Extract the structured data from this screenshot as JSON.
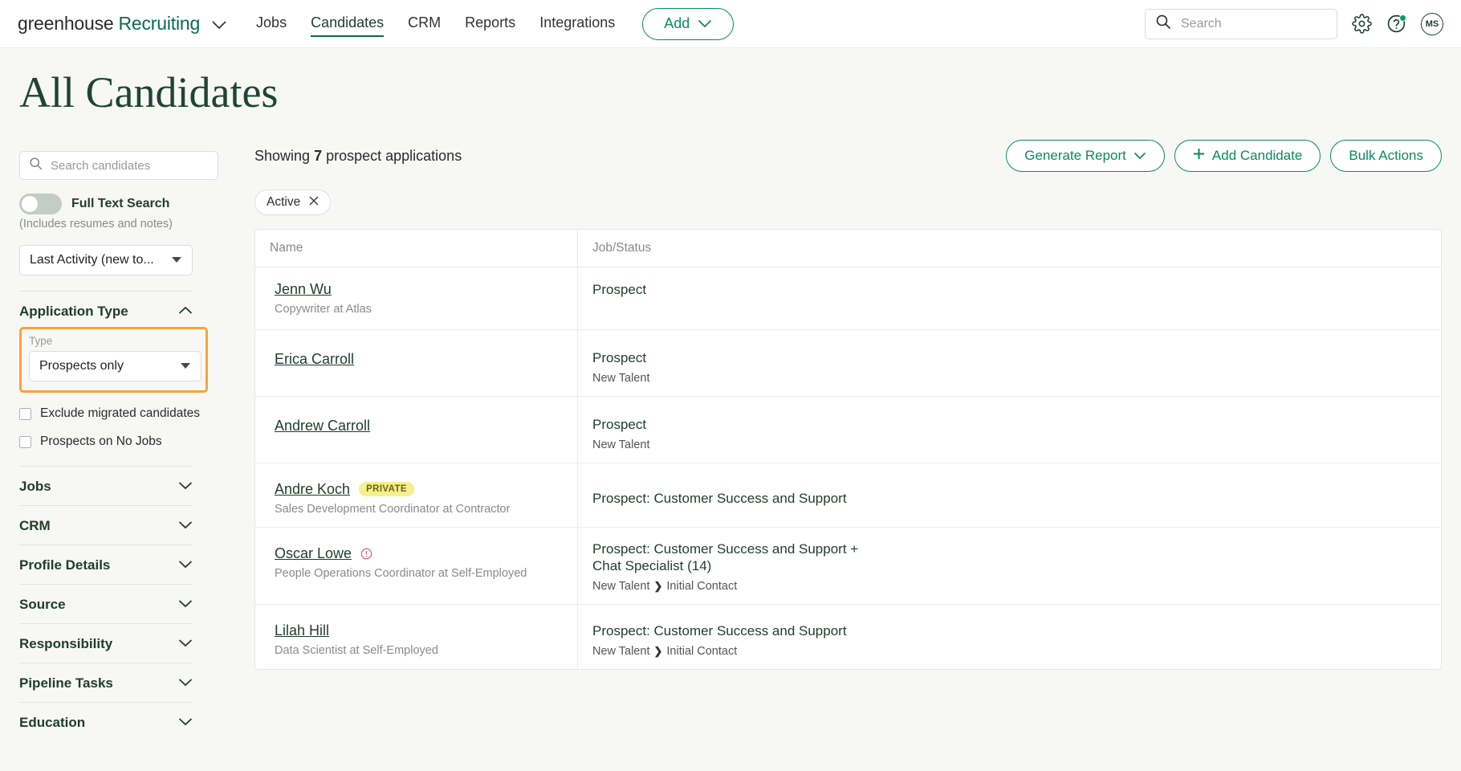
{
  "topnav": {
    "brand_word1": "greenhouse",
    "brand_word2": "Recruiting",
    "links": [
      {
        "label": "Jobs",
        "active": false
      },
      {
        "label": "Candidates",
        "active": true
      },
      {
        "label": "CRM",
        "active": false
      },
      {
        "label": "Reports",
        "active": false
      },
      {
        "label": "Integrations",
        "active": false
      }
    ],
    "add_button": "Add",
    "search_placeholder": "Search",
    "search_value": "",
    "avatar_initials": "MS",
    "icons": {
      "brand_caret": "chevron-down-icon",
      "search": "search-icon",
      "settings": "gear-icon",
      "help": "help-circle-icon",
      "avatar": "avatar"
    }
  },
  "page": {
    "title": "All Candidates"
  },
  "sidebar": {
    "search_placeholder": "Search candidates",
    "search_value": "",
    "full_text_search_label": "Full Text Search",
    "full_text_search_sub": "(Includes resumes and notes)",
    "full_text_search_on": false,
    "sort_select_value": "Last Activity (new to...",
    "application_type": {
      "title": "Application Type",
      "expanded": true,
      "type_field_label": "Type",
      "type_value": "Prospects only",
      "highlight_color": "#F9A33C",
      "checkboxes": [
        {
          "label": "Exclude migrated candidates",
          "checked": false
        },
        {
          "label": "Prospects on No Jobs",
          "checked": false
        }
      ]
    },
    "sections": [
      {
        "label": "Jobs",
        "expanded": false
      },
      {
        "label": "CRM",
        "expanded": false
      },
      {
        "label": "Profile Details",
        "expanded": false
      },
      {
        "label": "Source",
        "expanded": false
      },
      {
        "label": "Responsibility",
        "expanded": false
      },
      {
        "label": "Pipeline Tasks",
        "expanded": false
      },
      {
        "label": "Education",
        "expanded": false
      }
    ]
  },
  "main": {
    "showing_prefix": "Showing",
    "showing_count": "7",
    "showing_suffix": "prospect applications",
    "buttons": {
      "generate_report": "Generate Report",
      "add_candidate": "Add Candidate",
      "bulk_actions": "Bulk Actions"
    },
    "filter_chips": [
      {
        "label": "Active"
      }
    ],
    "table": {
      "columns": [
        "Name",
        "Job/Status"
      ],
      "rows": [
        {
          "name": "Jenn Wu",
          "subtitle": "Copywriter at Atlas",
          "private": false,
          "warning": false,
          "job": "Prospect",
          "stage": ""
        },
        {
          "name": "Erica Carroll",
          "subtitle": "",
          "private": false,
          "warning": false,
          "job": "Prospect",
          "stage": "New Talent"
        },
        {
          "name": "Andrew Carroll",
          "subtitle": "",
          "private": false,
          "warning": false,
          "job": "Prospect",
          "stage": "New Talent"
        },
        {
          "name": "Andre Koch",
          "subtitle": "Sales Development Coordinator at Contractor",
          "private": true,
          "private_label": "PRIVATE",
          "warning": false,
          "job": "Prospect: Customer Success and Support",
          "stage": ""
        },
        {
          "name": "Oscar Lowe",
          "subtitle": "People Operations Coordinator at Self-Employed",
          "private": false,
          "warning": true,
          "job": "Prospect: Customer Success and Support + Chat Specialist (14)",
          "stage": "New Talent",
          "stage2": "Initial Contact"
        },
        {
          "name": "Lilah Hill",
          "subtitle": "Data Scientist at Self-Employed",
          "private": false,
          "warning": false,
          "job": "Prospect: Customer Success and Support",
          "stage": "New Talent",
          "stage2": "Initial Contact"
        }
      ]
    }
  },
  "colors": {
    "brand_green": "#0B6B4F",
    "accent_green": "#0B8A5F",
    "dark_green": "#1F3D2B",
    "highlight_orange": "#F9A33C",
    "private_yellow": "#F6EF8E",
    "warning_red": "#D94C6A",
    "page_bg": "#F7F7F6"
  }
}
